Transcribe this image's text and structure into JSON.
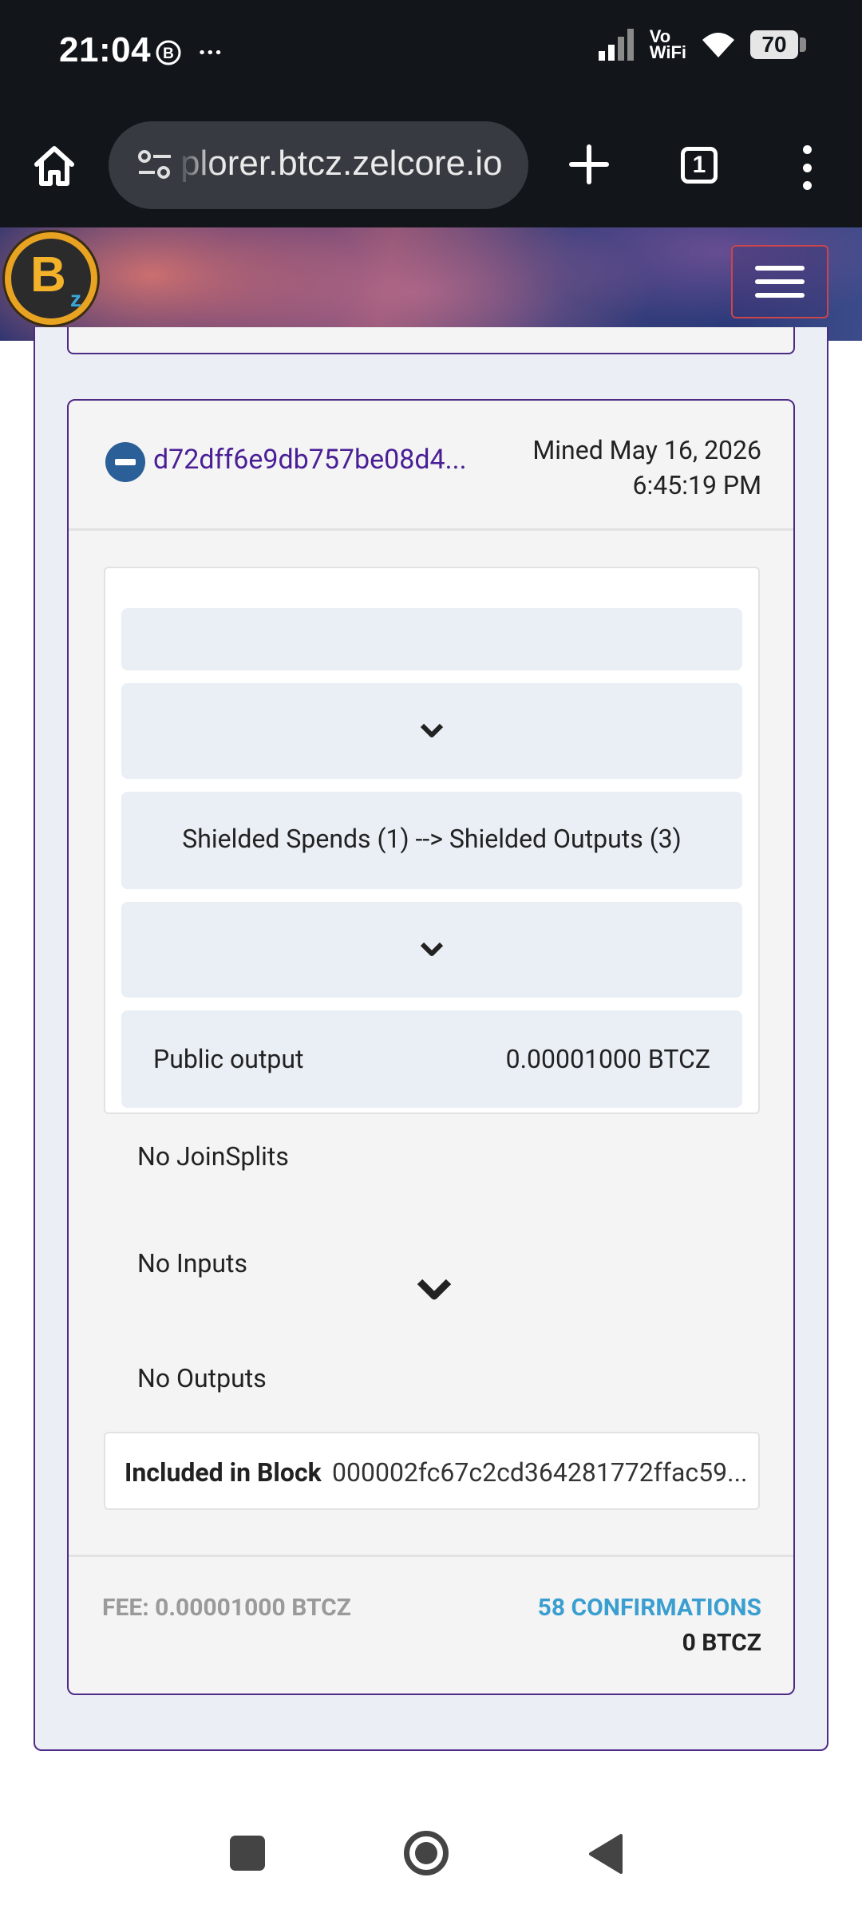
{
  "status_bar": {
    "time": "21:04",
    "bitcoin_icon": "bitcoin-circle-icon",
    "more": "···",
    "vowifi_top": "Vo",
    "vowifi_bottom": "WiFi",
    "battery": "70"
  },
  "browser": {
    "url": "plorer.btcz.zelcore.io",
    "tab_count": "1"
  },
  "transaction": {
    "hash": "d72dff6e9db757be08d4...",
    "mined_line1": "Mined May 16, 2026",
    "mined_line2": "6:45:19 PM",
    "shielded_summary": "Shielded Spends (1) --> Shielded Outputs (3)",
    "public_output_label": "Public output",
    "public_output_value": "0.00001000 BTCZ",
    "joinsplits": "No JoinSplits",
    "inputs": "No Inputs",
    "outputs": "No Outputs",
    "block_label": "Included in Block",
    "block_hash": "000002fc67c2cd364281772ffac59...",
    "fee": "FEE: 0.00001000 BTCZ",
    "confirmations": "58 CONFIRMATIONS",
    "amount": "0 BTCZ"
  },
  "colors": {
    "panel_border": "#4e2a84",
    "hash_link": "#4a1f96",
    "confirmations": "#3a9fd0",
    "minus_icon": "#2a5f98"
  }
}
